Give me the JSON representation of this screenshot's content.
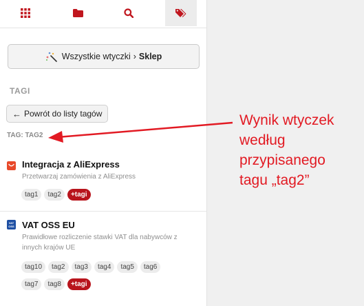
{
  "tabs": [
    {
      "icon": "grid-icon",
      "active": false
    },
    {
      "icon": "folder-icon",
      "active": false
    },
    {
      "icon": "search-icon",
      "active": false
    },
    {
      "icon": "tags-icon",
      "active": true
    }
  ],
  "breadcrumb": {
    "part1": "Wszystkie wtyczki",
    "separator": "›",
    "part2": "Sklep"
  },
  "section_title": "TAGI",
  "back_button": "Powrót do listy tagów",
  "tag_label": "TAG: TAG2",
  "plugins": [
    {
      "name": "Integracja z AliExpress",
      "description": "Przetwarzaj zamówienia z AliExpress",
      "tags": [
        "tag1",
        "tag2"
      ],
      "more": "+tagi"
    },
    {
      "name": "VAT OSS EU",
      "logo_text": "VAT OSS",
      "description": "Prawidłowe rozliczenie stawki VAT dla nabywców z innych krajów UE",
      "tags": [
        "tag10",
        "tag2",
        "tag3",
        "tag4",
        "tag5",
        "tag6",
        "tag7",
        "tag8"
      ],
      "more": "+tagi"
    }
  ],
  "annotation": {
    "lines": [
      "Wynik wtyczek",
      "według",
      "przypisanego",
      "tagu „tag2”"
    ],
    "color": "#e21a23"
  },
  "colors": {
    "accent": "#b8141c",
    "icon": "#c0161e"
  }
}
